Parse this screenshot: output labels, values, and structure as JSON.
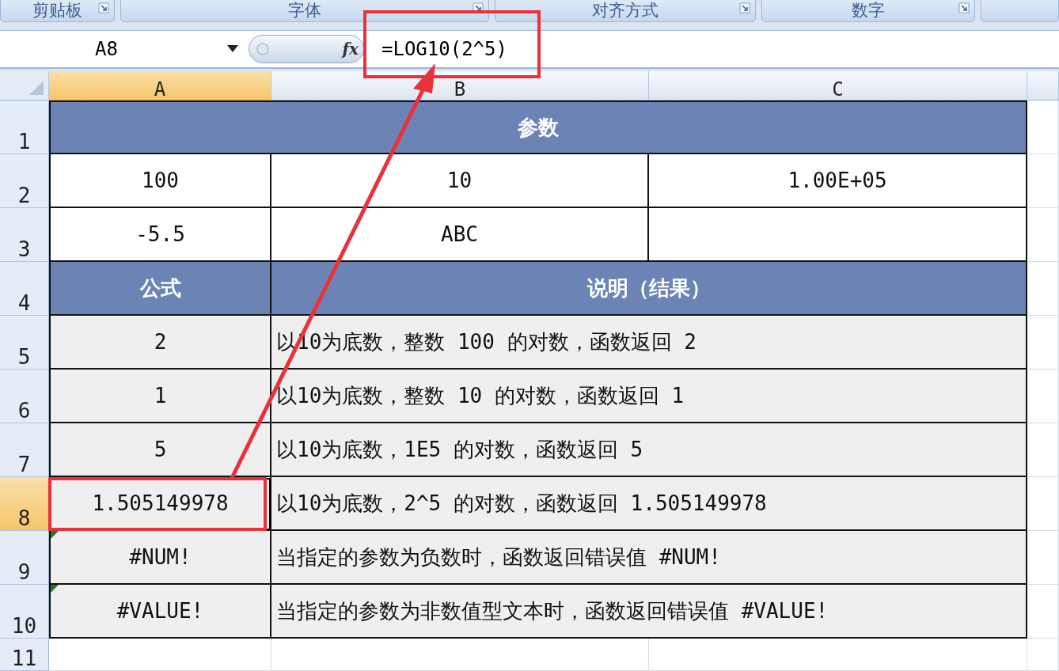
{
  "ribbon_groups": [
    {
      "label": "剪贴板"
    },
    {
      "label": "字体"
    },
    {
      "label": "对齐方式"
    },
    {
      "label": "数字"
    }
  ],
  "formula_bar": {
    "name_box": "A8",
    "function_label": "fx",
    "formula": "=LOG10(2^5)"
  },
  "columns": [
    {
      "label": "A",
      "selected": true
    },
    {
      "label": "B",
      "selected": false
    },
    {
      "label": "C",
      "selected": false
    }
  ],
  "rows": [
    {
      "number": "1",
      "selected": false,
      "shaded": false,
      "cells": [
        {
          "kind": "header",
          "text": "参数",
          "merged": true
        }
      ]
    },
    {
      "number": "2",
      "selected": false,
      "shaded": false,
      "cells": [
        {
          "kind": "value",
          "text": "100"
        },
        {
          "kind": "value",
          "text": "10"
        },
        {
          "kind": "value",
          "text": "1.00E+05"
        }
      ]
    },
    {
      "number": "3",
      "selected": false,
      "shaded": false,
      "cells": [
        {
          "kind": "value",
          "text": "-5.5"
        },
        {
          "kind": "value",
          "text": "ABC"
        }
      ]
    },
    {
      "number": "4",
      "selected": false,
      "shaded": false,
      "cells": [
        {
          "kind": "header",
          "text": "公式"
        },
        {
          "kind": "header",
          "text": "说明（结果）",
          "merged": true
        }
      ]
    },
    {
      "number": "5",
      "selected": false,
      "shaded": true,
      "cells": [
        {
          "kind": "value",
          "text": "2"
        },
        {
          "kind": "note",
          "text": "以10为底数，整数 100 的对数，函数返回 2",
          "merged": true
        }
      ]
    },
    {
      "number": "6",
      "selected": false,
      "shaded": true,
      "cells": [
        {
          "kind": "value",
          "text": "1"
        },
        {
          "kind": "note",
          "text": "以10为底数，整数 10 的对数，函数返回 1",
          "merged": true
        }
      ]
    },
    {
      "number": "7",
      "selected": false,
      "shaded": true,
      "cells": [
        {
          "kind": "value",
          "text": "5"
        },
        {
          "kind": "note",
          "text": "以10为底数，1E5 的对数，函数返回 5",
          "merged": true
        }
      ]
    },
    {
      "number": "8",
      "selected": true,
      "shaded": true,
      "cells": [
        {
          "kind": "value",
          "text": "1.505149978",
          "selected": true
        },
        {
          "kind": "note",
          "text": "以10为底数，2^5 的对数，函数返回 1.505149978",
          "merged": true
        }
      ]
    },
    {
      "number": "9",
      "selected": false,
      "shaded": true,
      "cells": [
        {
          "kind": "value",
          "text": "#NUM!",
          "error_flag": true
        },
        {
          "kind": "note",
          "text": "当指定的参数为负数时，函数返回错误值 #NUM!",
          "merged": true
        }
      ]
    },
    {
      "number": "10",
      "selected": false,
      "shaded": true,
      "cells": [
        {
          "kind": "value",
          "text": "#VALUE!",
          "error_flag": true
        },
        {
          "kind": "note",
          "text": "当指定的参数为非数值型文本时，函数返回错误值 #VALUE!",
          "merged": true
        }
      ]
    },
    {
      "number": "11",
      "selected": false,
      "shaded": false,
      "cells": []
    }
  ]
}
